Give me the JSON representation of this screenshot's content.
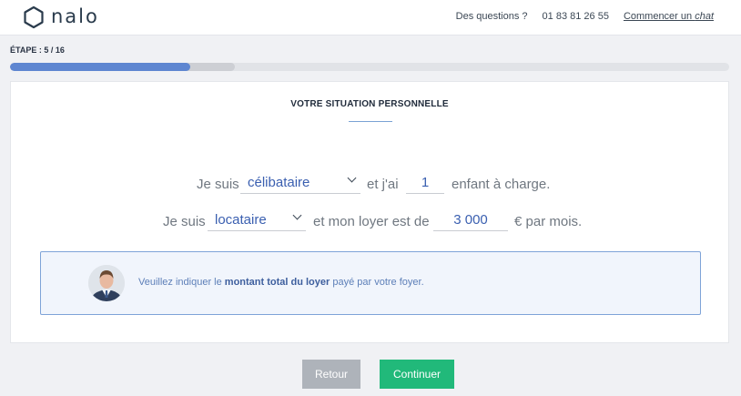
{
  "brand": {
    "name": "nalo"
  },
  "header": {
    "questions_label": "Des questions ?",
    "phone": "01 83 81 26 55",
    "chat_prefix": "Commencer un ",
    "chat_emphasis": "chat"
  },
  "progress": {
    "step_label": "ÉTAPE : 5 / 16",
    "current_step": 5,
    "total_steps": 16,
    "fill_fraction": 0.25
  },
  "section": {
    "title": "VOTRE SITUATION PERSONNELLE"
  },
  "form": {
    "line1": {
      "prefix": "Je suis",
      "status_value": "célibataire",
      "middle": "et j'ai",
      "children_value": "1",
      "suffix": "enfant à charge."
    },
    "line2": {
      "prefix": "Je suis",
      "housing_value": "locataire",
      "middle": "et mon loyer est de",
      "rent_value": "3 000",
      "suffix": "€ par mois."
    }
  },
  "info": {
    "text_before": "Veuillez indiquer le ",
    "text_strong": "montant total du loyer",
    "text_after": " payé par votre foyer."
  },
  "actions": {
    "back_label": "Retour",
    "next_label": "Continuer"
  },
  "colors": {
    "accent": "#5e86d1",
    "primary_button": "#21b97a",
    "secondary_button": "#aeb3ba",
    "value_text": "#3a5fb0"
  }
}
